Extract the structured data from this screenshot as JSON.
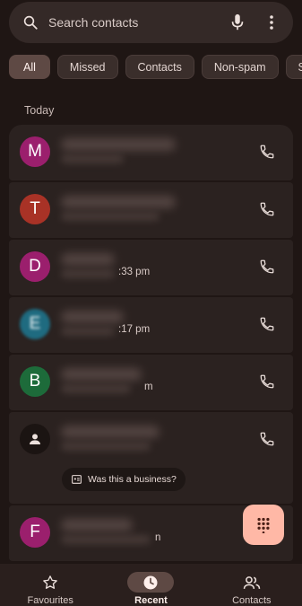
{
  "search": {
    "placeholder": "Search contacts"
  },
  "filters": [
    "All",
    "Missed",
    "Contacts",
    "Non-spam",
    "S"
  ],
  "section": "Today",
  "calls": [
    {
      "initial": "M",
      "color": "#9b1f6d",
      "time": ""
    },
    {
      "initial": "T",
      "color": "#a83226",
      "time": ""
    },
    {
      "initial": "D",
      "color": "#9b1f6d",
      "time": ":33 pm"
    },
    {
      "initial": "E",
      "color": "#1f6b80",
      "time": ":17 pm"
    },
    {
      "initial": "B",
      "color": "#1d6b3a",
      "time": "m"
    },
    {
      "initial": "",
      "color": "#1b1412",
      "time": ""
    },
    {
      "initial": "F",
      "color": "#9b1f6d",
      "time": "n"
    }
  ],
  "business_prompt": "Was this a business?",
  "nav": {
    "favourites": "Favourites",
    "recent": "Recent",
    "contacts": "Contacts"
  },
  "colors": {
    "background": "#1f1614",
    "accent": "#ffb8a6",
    "surface": "#2b2220"
  }
}
